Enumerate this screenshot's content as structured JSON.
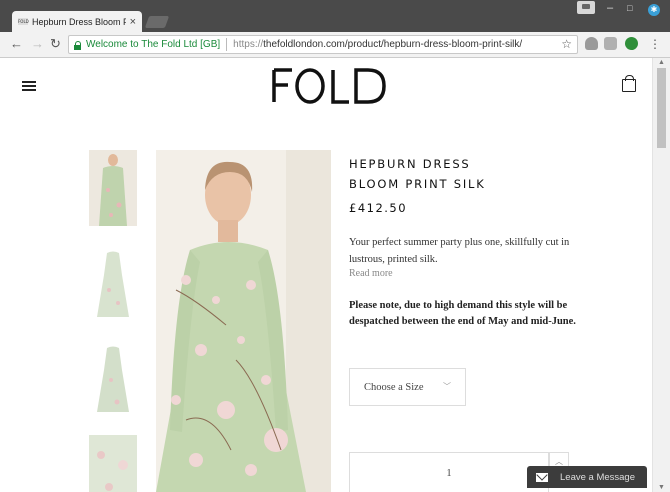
{
  "browser": {
    "tab_title": "Hepburn Dress Bloom Pr",
    "tab_favicon_text": "FOLD",
    "close_glyph": "×",
    "secure_label": "Welcome to The Fold Ltd [GB]",
    "url_scheme": "https://",
    "url_rest": "thefoldlondon.com/product/hepburn-dress-bloom-print-silk/",
    "win_minimize": "–",
    "win_maximize": "□",
    "win_close": "✕",
    "back": "←",
    "forward": "→",
    "reload": "↻",
    "bookmark": "☆",
    "menu": "⋮"
  },
  "site": {
    "logo": "FOLD",
    "menu_icon": "hamburger-icon",
    "bag_icon": "shopping-bag-icon"
  },
  "product": {
    "title_line1": "HEPBURN DRESS",
    "title_line2": "BLOOM PRINT SILK",
    "price": "£412.50",
    "description": "Your perfect summer party plus one, skillfully cut in lustrous, printed silk.",
    "read_more": "Read more",
    "note": "Please note, due to high demand this style will be despatched between the end of May and mid-June.",
    "size_placeholder": "Choose a Size",
    "quantity": "1",
    "accent_color": "#b9cfa9"
  },
  "chat": {
    "label": "Leave a Message"
  }
}
